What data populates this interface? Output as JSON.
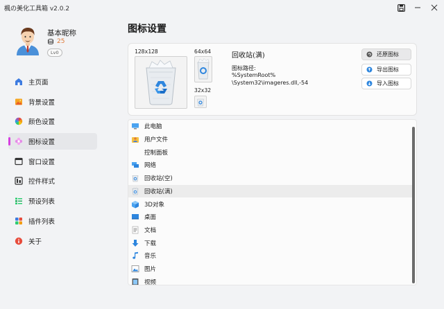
{
  "window": {
    "title": "楓の美化工具箱 v2.0.2"
  },
  "profile": {
    "nickname": "基本昵称",
    "coins": "25",
    "level": "Lv0"
  },
  "nav": {
    "items": [
      {
        "label": "主页面",
        "icon": "home-icon"
      },
      {
        "label": "背景设置",
        "icon": "image-icon"
      },
      {
        "label": "颜色设置",
        "icon": "color-wheel-icon"
      },
      {
        "label": "图标设置",
        "icon": "flower-icon",
        "active": true
      },
      {
        "label": "窗口设置",
        "icon": "window-icon"
      },
      {
        "label": "控件样式",
        "icon": "controls-icon"
      },
      {
        "label": "预设列表",
        "icon": "preset-list-icon"
      },
      {
        "label": "插件列表",
        "icon": "plugin-grid-icon"
      },
      {
        "label": "关于",
        "icon": "info-icon"
      }
    ]
  },
  "main": {
    "title": "图标设置",
    "preview": {
      "size_large": "128x128",
      "size_medium": "64x64",
      "size_small": "32x32",
      "icon_name": "回收站(满)",
      "path_label": "图标路径:",
      "path_line1": "%SystemRoot%",
      "path_line2": "\\System32\\imageres.dll,-54"
    },
    "actions": {
      "restore": "还原图标",
      "export": "导出图标",
      "import": "导入图标"
    },
    "list": [
      {
        "label": "此电脑",
        "icon": "computer-icon"
      },
      {
        "label": "用户文件",
        "icon": "user-folder-icon"
      },
      {
        "label": "控制面板",
        "icon": "control-panel-icon"
      },
      {
        "label": "网络",
        "icon": "network-icon"
      },
      {
        "label": "回收站(空)",
        "icon": "recycle-bin-empty-icon"
      },
      {
        "label": "回收站(满)",
        "icon": "recycle-bin-full-icon",
        "selected": true
      },
      {
        "label": "3D对象",
        "icon": "3d-objects-icon"
      },
      {
        "label": "桌面",
        "icon": "desktop-icon"
      },
      {
        "label": "文档",
        "icon": "documents-icon"
      },
      {
        "label": "下载",
        "icon": "download-icon"
      },
      {
        "label": "音乐",
        "icon": "music-icon"
      },
      {
        "label": "图片",
        "icon": "pictures-icon"
      },
      {
        "label": "视频",
        "icon": "videos-icon"
      }
    ]
  },
  "colors": {
    "accent": "#d63ee0",
    "coin": "#e07b39",
    "background": "#f2f3f5"
  }
}
